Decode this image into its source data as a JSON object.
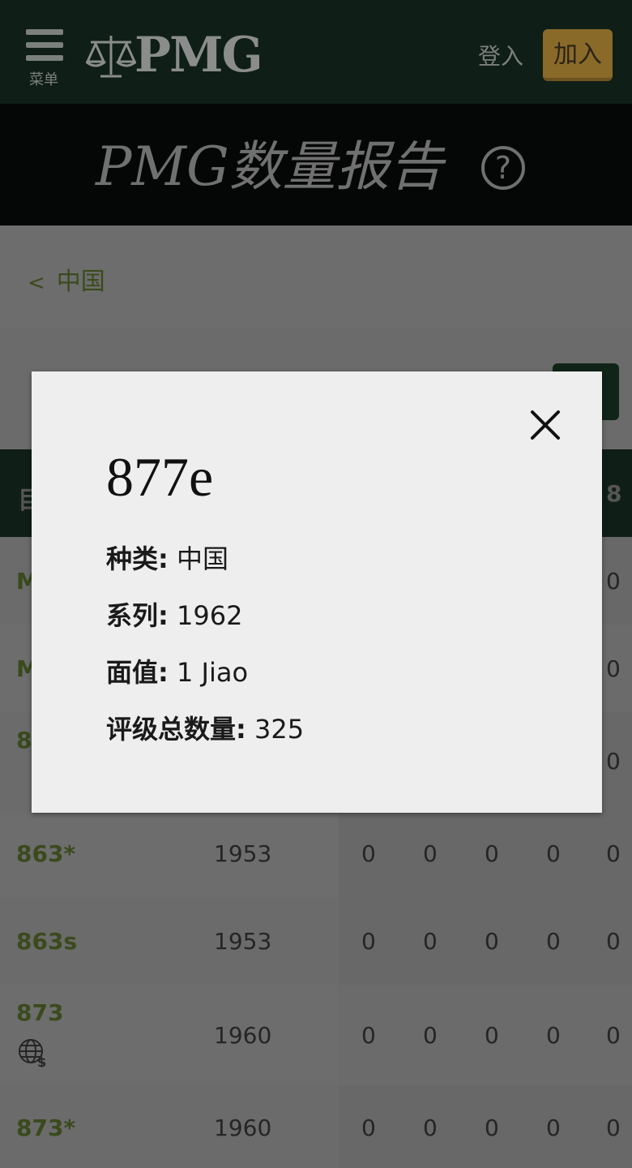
{
  "header": {
    "menu_label": "菜单",
    "logo_text": "PMG",
    "login_label": "登入",
    "join_label": "加入"
  },
  "title": "PMG数量报告",
  "breadcrumb": {
    "back": "<",
    "label": "中国"
  },
  "table_head": {
    "left": "目",
    "right": "8"
  },
  "rows": [
    {
      "num": "M",
      "year": "",
      "last": "0"
    },
    {
      "num": "M",
      "year": "",
      "last": "0"
    },
    {
      "num": "8",
      "year": "",
      "last": "0"
    },
    {
      "num": "863*",
      "year": "1953",
      "zeros": [
        "0",
        "0",
        "0",
        "0",
        "0"
      ]
    },
    {
      "num": "863s",
      "year": "1953",
      "zeros": [
        "0",
        "0",
        "0",
        "0",
        "0"
      ]
    },
    {
      "num": "873",
      "year": "1960",
      "zeros": [
        "0",
        "0",
        "0",
        "0",
        "0"
      ]
    },
    {
      "num": "873*",
      "year": "1960",
      "zeros": [
        "0",
        "0",
        "0",
        "0",
        "0"
      ]
    }
  ],
  "modal": {
    "title": "877e",
    "fields": [
      {
        "label": "种类:",
        "value": " 中国"
      },
      {
        "label": "系列:",
        "value": " 1962"
      },
      {
        "label": "面值:",
        "value": " 1 Jiao"
      },
      {
        "label": "评级总数量:",
        "value": " 325"
      }
    ]
  },
  "colors": {
    "header_bg": "#0f1e17",
    "join_button": "#8a6a29",
    "link_green": "#3a4a1d",
    "modal_bg": "#eeeeee"
  },
  "icons": [
    "menu-icon",
    "scales-logo-icon",
    "help-icon",
    "close-icon",
    "globe-dollar-icon"
  ]
}
